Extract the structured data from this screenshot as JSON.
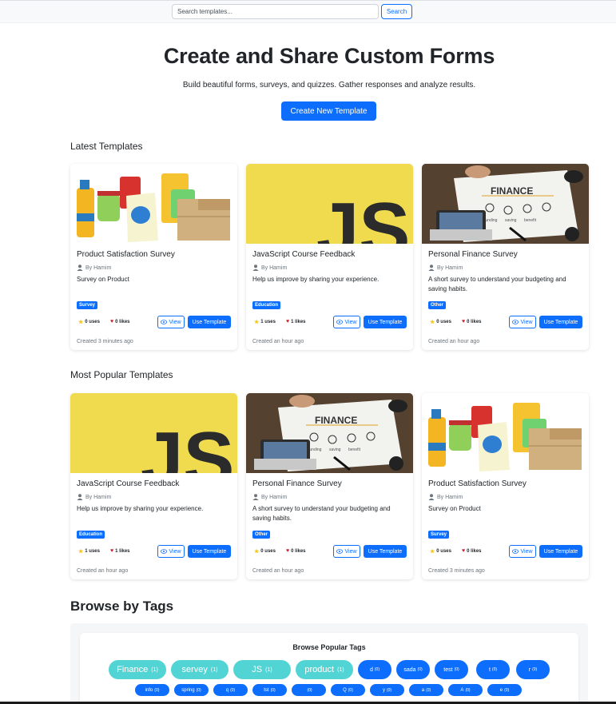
{
  "search": {
    "placeholder": "Search templates...",
    "button": "Search"
  },
  "hero": {
    "title": "Create and Share Custom Forms",
    "subtitle": "Build beautiful forms, surveys, and quizzes. Gather responses and analyze results.",
    "cta": "Create New Template"
  },
  "sections": {
    "latest": "Latest Templates",
    "popular": "Most Popular Templates",
    "browse": "Browse by Tags"
  },
  "card_labels": {
    "view": "View",
    "use": "Use Template"
  },
  "latest": [
    {
      "image": "groceries-photo",
      "title": "Product Satisfaction Survey",
      "author": "By Hamim",
      "description": "Survey on Product",
      "tag": "Survey",
      "uses": "0 uses",
      "likes": "0 likes",
      "created": "Created 3 minutes ago"
    },
    {
      "image": "js-logo",
      "title": "JavaScript Course Feedback",
      "author": "By Hamim",
      "description": "Help us improve by sharing your experience.",
      "tag": "Education",
      "uses": "1 uses",
      "likes": "1 likes",
      "created": "Created an hour ago"
    },
    {
      "image": "finance-photo",
      "title": "Personal Finance Survey",
      "author": "By Hamim",
      "description": "A short survey to understand your budgeting and saving habits.",
      "tag": "Other",
      "uses": "0 uses",
      "likes": "0 likes",
      "created": "Created an hour ago"
    }
  ],
  "popular": [
    {
      "image": "js-logo",
      "title": "JavaScript Course Feedback",
      "author": "By Hamim",
      "description": "Help us improve by sharing your experience.",
      "tag": "Education",
      "uses": "1 uses",
      "likes": "1 likes",
      "created": "Created an hour ago"
    },
    {
      "image": "finance-photo",
      "title": "Personal Finance Survey",
      "author": "By Hamim",
      "description": "A short survey to understand your budgeting and saving habits.",
      "tag": "Other",
      "uses": "0 uses",
      "likes": "0 likes",
      "created": "Created an hour ago"
    },
    {
      "image": "groceries-photo",
      "title": "Product Satisfaction Survey",
      "author": "By Hamim",
      "description": "Survey on Product",
      "tag": "Survey",
      "uses": "0 uses",
      "likes": "0 likes",
      "created": "Created 3 minutes ago"
    }
  ],
  "image_text": {
    "js": "JS",
    "finance": "FINANCE",
    "finance_words": [
      "funding",
      "saving",
      "benefit"
    ]
  },
  "tags": {
    "heading": "Browse Popular Tags",
    "row1": [
      {
        "name": "Finance",
        "count": "(1)"
      },
      {
        "name": "servey",
        "count": "(1)"
      },
      {
        "name": "JS",
        "count": "(1)"
      },
      {
        "name": "product",
        "count": "(1)"
      },
      {
        "name": "d",
        "count": "(0)"
      },
      {
        "name": "sada",
        "count": "(0)"
      },
      {
        "name": "test",
        "count": "(0)"
      },
      {
        "name": "t",
        "count": "(0)"
      },
      {
        "name": "r",
        "count": "(0)"
      }
    ],
    "row2": [
      {
        "name": "info",
        "count": "(0)"
      },
      {
        "name": "spring",
        "count": "(0)"
      },
      {
        "name": "q",
        "count": "(0)"
      },
      {
        "name": "tst",
        "count": "(0)"
      },
      {
        "name": "",
        "count": "(0)"
      },
      {
        "name": "Q",
        "count": "(0)"
      },
      {
        "name": "y",
        "count": "(0)"
      },
      {
        "name": "a",
        "count": "(0)"
      },
      {
        "name": "A",
        "count": "(0)"
      },
      {
        "name": "e",
        "count": "(0)"
      }
    ]
  },
  "colors": {
    "primary": "#0d6efd",
    "tag_highlight": "#52d4d4",
    "js_yellow": "#f0db4f"
  }
}
